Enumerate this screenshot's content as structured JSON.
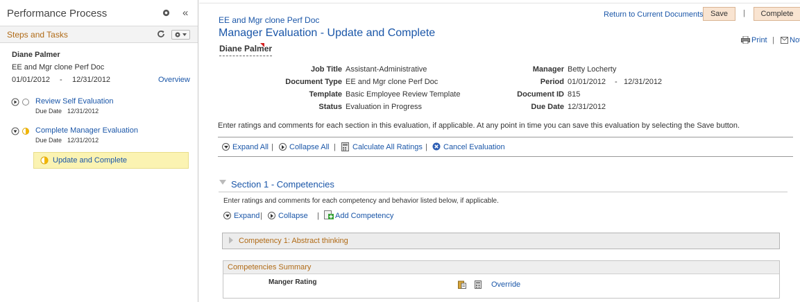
{
  "left_panel": {
    "title": "Performance Process",
    "collapse_glyph": "«",
    "steps_title": "Steps and Tasks",
    "employee_name": "Diane Palmer",
    "document_name": "EE and Mgr clone Perf Doc",
    "period_start": "01/01/2012",
    "period_separator": "-",
    "period_end": "12/31/2012",
    "overview_link": "Overview",
    "tasks": [
      {
        "label": "Review Self Evaluation",
        "due_label": "Due Date",
        "due_date": "12/31/2012"
      },
      {
        "label": "Complete Manager Evaluation",
        "due_label": "Due Date",
        "due_date": "12/31/2012"
      }
    ],
    "active_step": "Update and Complete"
  },
  "header": {
    "document_name": "EE and Mgr clone Perf Doc",
    "return_link": "Return to Current Documents",
    "save_label": "Save",
    "separator": "|",
    "complete_label": "Complete",
    "page_title": "Manager Evaluation - Update and Complete",
    "employee_name": "Diane Palmer",
    "print_label": "Print",
    "notify_label": "Notify"
  },
  "details": {
    "left": [
      {
        "label": "Job Title",
        "value": "Assistant-Administrative"
      },
      {
        "label": "Document Type",
        "value": "EE and Mgr clone Perf Doc"
      },
      {
        "label": "Template",
        "value": "Basic Employee Review Template"
      },
      {
        "label": "Status",
        "value": "Evaluation in Progress"
      }
    ],
    "right": [
      {
        "label": "Manager",
        "value": "Betty Locherty"
      },
      {
        "label": "Period",
        "value": "01/01/2012",
        "separator": "-",
        "value2": "12/31/2012"
      },
      {
        "label": "Document ID",
        "value": "815"
      },
      {
        "label": "Due Date",
        "value": "12/31/2012"
      }
    ]
  },
  "instructions": "Enter ratings and comments for each section in this evaluation, if applicable. At any point in time you can save this evaluation by selecting the Save button.",
  "toolbar": {
    "expand_all": "Expand All",
    "collapse_all": "Collapse All",
    "calculate_all": "Calculate All Ratings",
    "cancel_evaluation": "Cancel Evaluation"
  },
  "section": {
    "title": "Section 1 - Competencies",
    "description": "Enter ratings and comments for each competency and behavior listed below, if applicable.",
    "expand": "Expand",
    "collapse": "Collapse",
    "add_competency": "Add Competency",
    "competency_title": "Competency 1: Abstract thinking",
    "summary_title": "Competencies Summary",
    "rating_label": "Manger Rating",
    "override_link": "Override"
  },
  "colors": {
    "link_blue": "#1a56a8",
    "section_orange": "#b06a15",
    "button_fill": "#f9e4d1",
    "active_highlight": "#fbf3b2",
    "status_yellow": "#f2b600"
  },
  "icons": [
    "gear-icon",
    "refresh-icon",
    "options-menu-icon",
    "expand-icon",
    "collapse-icon",
    "calculator-icon",
    "cancel-icon",
    "print-icon",
    "notify-icon",
    "add-icon",
    "clipboard-icon"
  ]
}
